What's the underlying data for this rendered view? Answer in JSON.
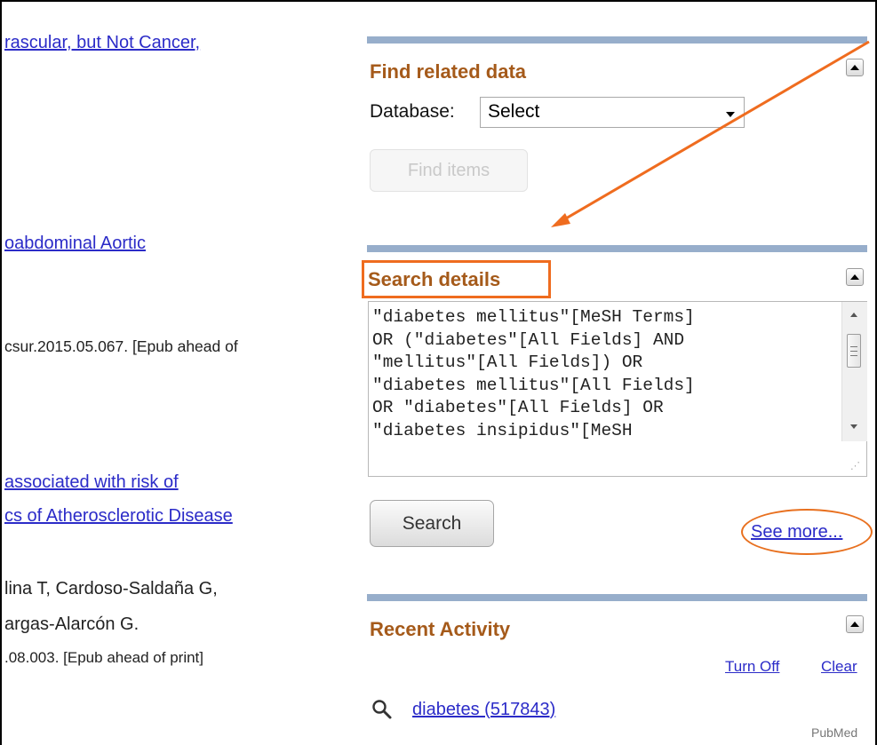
{
  "left_column": {
    "lines": [
      "rascular, but Not Cancer,",
      "oabdominal Aortic",
      "csur.2015.05.067. [Epub ahead of",
      "associated with risk of",
      "cs of Atherosclerotic Disease",
      "lina T, Cardoso-Saldaña G,",
      "argas-Alarcón G.",
      ".08.003. [Epub ahead of print]"
    ]
  },
  "find_related": {
    "heading": "Find related data",
    "database_label": "Database:",
    "database_selected": "Select",
    "find_button": "Find items"
  },
  "search_details": {
    "heading": "Search details",
    "query_text": "\"diabetes mellitus\"[MeSH Terms]\nOR (\"diabetes\"[All Fields] AND\n\"mellitus\"[All Fields]) OR\n\"diabetes mellitus\"[All Fields]\nOR \"diabetes\"[All Fields] OR\n\"diabetes insipidus\"[MeSH",
    "search_button": "Search",
    "see_more": "See more..."
  },
  "recent_activity": {
    "heading": "Recent Activity",
    "turn_off": "Turn Off",
    "clear": "Clear",
    "items": [
      {
        "text": "diabetes (517843)",
        "icon": "search-icon",
        "source": "PubMed"
      }
    ]
  },
  "colors": {
    "heading": "#a55a1a",
    "section_bar": "#97aecb",
    "link": "#2b2bc8",
    "annotation": "#ef6c1f"
  }
}
